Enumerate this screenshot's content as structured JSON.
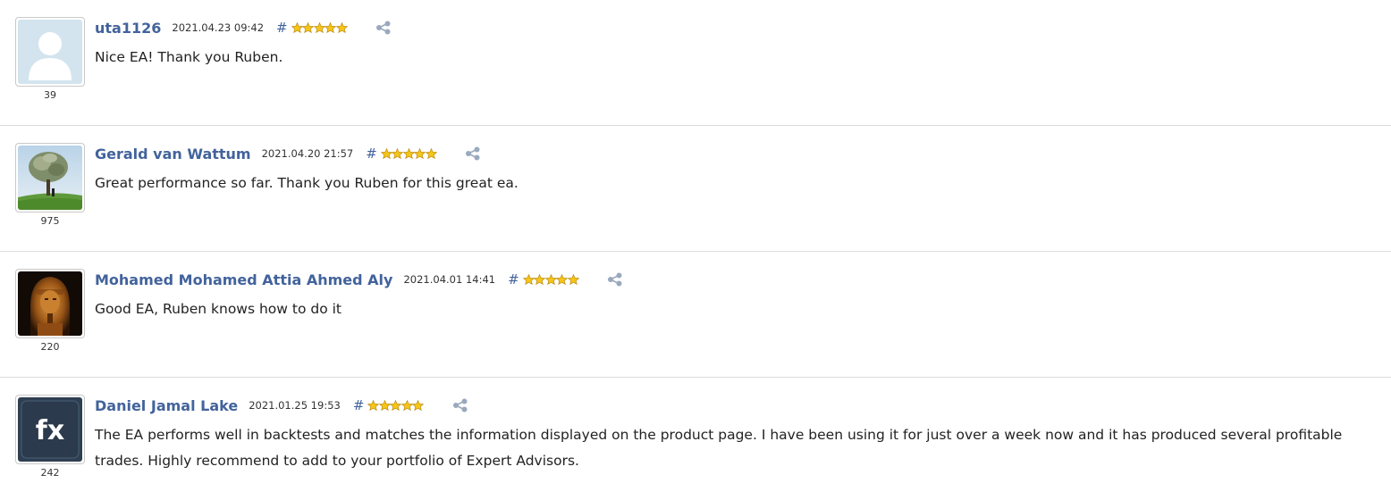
{
  "reviews": [
    {
      "author": "uta1126",
      "date": "2021.04.23 09:42",
      "hash": "#",
      "stars": 5,
      "rating": "39",
      "avatar": "default-user-icon",
      "text": "Nice EA! Thank you Ruben."
    },
    {
      "author": "Gerald van Wattum",
      "date": "2021.04.20 21:57",
      "hash": "#",
      "stars": 5,
      "rating": "975",
      "avatar": "money-tree-photo",
      "text": "Great performance so far. Thank you Ruben for this great ea."
    },
    {
      "author": "Mohamed Mohamed Attia Ahmed Aly",
      "date": "2021.04.01 14:41",
      "hash": "#",
      "stars": 5,
      "rating": "220",
      "avatar": "pharaoh-statue-photo",
      "text": "Good EA, Ruben knows how to do it"
    },
    {
      "author": "Daniel Jamal Lake",
      "date": "2021.01.25 19:53",
      "hash": "#",
      "stars": 5,
      "rating": "242",
      "avatar": "fx-logo",
      "avatar_text": "fx",
      "text": "The EA performs well in backtests and matches the information displayed on the product page. I have been using it for just over a week now and it has produced several profitable trades. Highly recommend to add to your portfolio of Expert Advisors."
    }
  ],
  "colors": {
    "link": "#42639c",
    "star": "#f5c518",
    "share": "#9aa9bd",
    "divider": "#dcdcdc"
  }
}
